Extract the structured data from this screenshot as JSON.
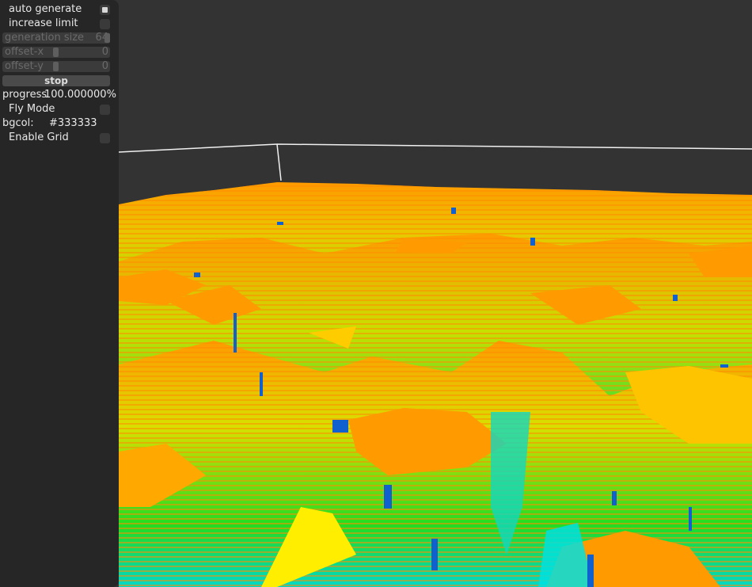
{
  "panel": {
    "auto_generate": {
      "label": "auto generate",
      "checked": true
    },
    "increase_limit": {
      "label": "increase limit",
      "checked": false
    },
    "generation_size": {
      "label": "generation size",
      "value": "64"
    },
    "offset_x": {
      "label": "offset-x",
      "value": "0"
    },
    "offset_y": {
      "label": "offset-y",
      "value": "0"
    },
    "stop_button": {
      "label": "stop"
    },
    "progress": {
      "label": "progress",
      "value": "100.000000%"
    },
    "fly_mode": {
      "label": "Fly Mode",
      "checked": false
    },
    "bgcol": {
      "label": "bgcol:",
      "value": "#333333"
    },
    "enable_grid": {
      "label": "Enable Grid",
      "checked": false
    }
  },
  "colors": {
    "background": "#333333",
    "terrain_high": "#ff9a00",
    "terrain_mid": "#d8e000",
    "terrain_low": "#22dd22",
    "terrain_deep": "#00e0e0",
    "water": "#1060d0"
  }
}
